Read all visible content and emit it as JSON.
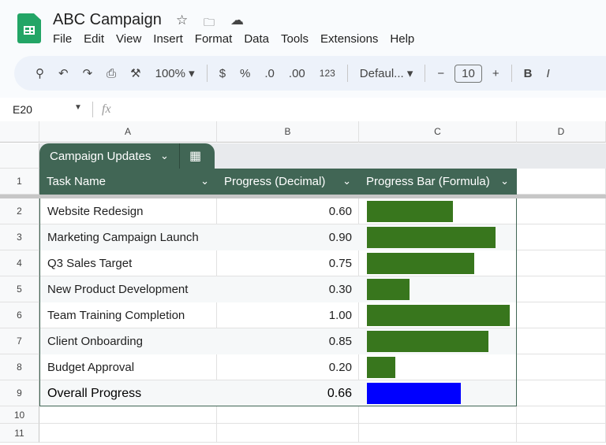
{
  "app": {
    "title": "ABC Campaign",
    "menu": [
      "File",
      "Edit",
      "View",
      "Insert",
      "Format",
      "Data",
      "Tools",
      "Extensions",
      "Help"
    ]
  },
  "toolbar": {
    "zoom": "100%",
    "currency": "$",
    "percent": "%",
    "decrease_decimal": ".0",
    "increase_decimal": ".00",
    "number_format": "123",
    "font": "Defaul...",
    "font_size": "10",
    "minus": "−",
    "plus": "+",
    "bold": "B",
    "italic": "I"
  },
  "formula_bar": {
    "cell_ref": "E20",
    "fx": "fx"
  },
  "columns": [
    "A",
    "B",
    "C",
    "D"
  ],
  "row_numbers": [
    "1",
    "2",
    "3",
    "4",
    "5",
    "6",
    "7",
    "8",
    "9",
    "10",
    "11"
  ],
  "table": {
    "name": "Campaign Updates",
    "headers": [
      "Task Name",
      "Progress (Decimal)",
      "Progress Bar (Formula)"
    ],
    "rows": [
      {
        "task": "Website Redesign",
        "progress": "0.60",
        "value": 0.6
      },
      {
        "task": "Marketing Campaign Launch",
        "progress": "0.90",
        "value": 0.9
      },
      {
        "task": "Q3 Sales Target",
        "progress": "0.75",
        "value": 0.75
      },
      {
        "task": "New Product Development",
        "progress": "0.30",
        "value": 0.3
      },
      {
        "task": "Team Training Completion",
        "progress": "1.00",
        "value": 1.0
      },
      {
        "task": "Client Onboarding",
        "progress": "0.85",
        "value": 0.85
      },
      {
        "task": "Budget Approval",
        "progress": "0.20",
        "value": 0.2
      }
    ],
    "total": {
      "task": "Overall Progress",
      "progress": "0.66",
      "value": 0.66
    }
  },
  "colors": {
    "header": "#416655",
    "bar": "#38761d",
    "total_bar": "#0000ff"
  }
}
